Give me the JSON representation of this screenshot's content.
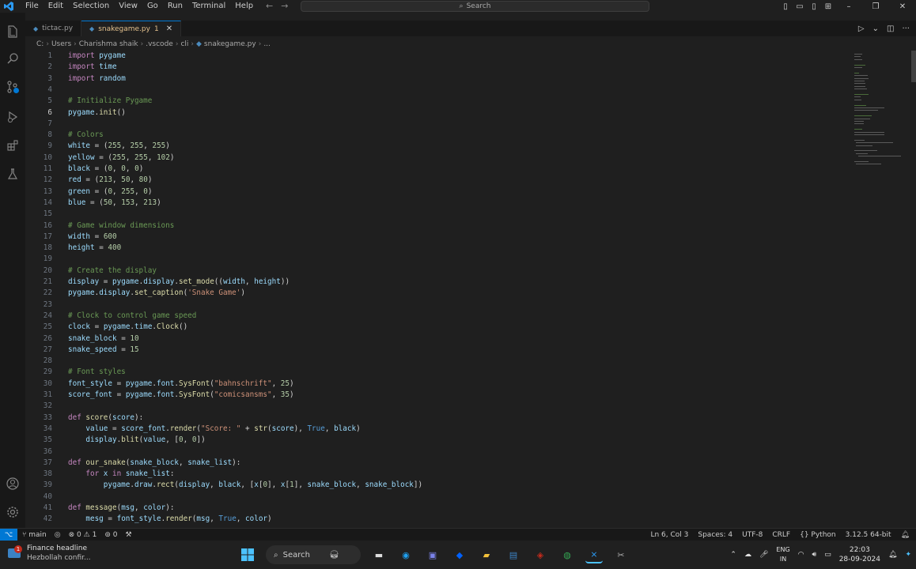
{
  "menu": [
    "File",
    "Edit",
    "Selection",
    "View",
    "Go",
    "Run",
    "Terminal",
    "Help"
  ],
  "search": {
    "label": "Search"
  },
  "tabs": [
    {
      "label": "tictac.py",
      "active": false
    },
    {
      "label": "snakegame.py",
      "badge": "1",
      "active": true
    }
  ],
  "breadcrumb": [
    "C:",
    "Users",
    "Charishma shaik",
    ".vscode",
    "cli",
    "snakegame.py",
    "..."
  ],
  "code_lines": [
    "import pygame",
    "import time",
    "import random",
    "",
    "# Initialize Pygame",
    "pygame.init()",
    "",
    "# Colors",
    "white = (255, 255, 255)",
    "yellow = (255, 255, 102)",
    "black = (0, 0, 0)",
    "red = (213, 50, 80)",
    "green = (0, 255, 0)",
    "blue = (50, 153, 213)",
    "",
    "# Game window dimensions",
    "width = 600",
    "height = 400",
    "",
    "# Create the display",
    "display = pygame.display.set_mode((width, height))",
    "pygame.display.set_caption('Snake Game')",
    "",
    "# Clock to control game speed",
    "clock = pygame.time.Clock()",
    "snake_block = 10",
    "snake_speed = 15",
    "",
    "# Font styles",
    "font_style = pygame.font.SysFont(\"bahnschrift\", 25)",
    "score_font = pygame.font.SysFont(\"comicsansms\", 35)",
    "",
    "def score(score):",
    "    value = score_font.render(\"Score: \" + str(score), True, black)",
    "    display.blit(value, [0, 0])",
    "",
    "def our_snake(snake_block, snake_list):",
    "    for x in snake_list:",
    "        pygame.draw.rect(display, black, [x[0], x[1], snake_block, snake_block])",
    "",
    "def message(msg, color):",
    "    mesg = font_style.render(msg, True, color)"
  ],
  "current_line": 6,
  "status": {
    "branch": "main",
    "errors": "0",
    "warnings": "1",
    "ports": "0",
    "cursor": "Ln 6, Col 3",
    "spaces": "Spaces: 4",
    "encoding": "UTF-8",
    "eol": "CRLF",
    "language": "Python",
    "interpreter": "3.12.5 64-bit"
  },
  "taskbar": {
    "weather_title": "Finance headline",
    "weather_sub": "Hezbollah confir...",
    "notif_badge": "1",
    "search_label": "Search",
    "lang_top": "ENG",
    "lang_bottom": "IN",
    "time": "22:03",
    "date": "28-09-2024"
  },
  "colors": {
    "accent": "#0078d4",
    "modified_tab": "#e2c08d"
  }
}
